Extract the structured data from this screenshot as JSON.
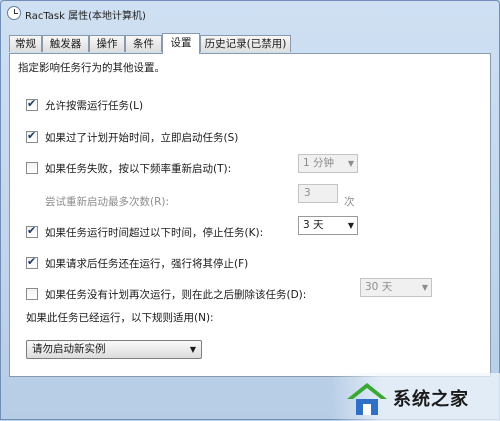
{
  "window": {
    "title": "RacTask 属性(本地计算机)"
  },
  "tabs": [
    {
      "label": "常规"
    },
    {
      "label": "触发器"
    },
    {
      "label": "操作"
    },
    {
      "label": "条件"
    },
    {
      "label": "设置"
    },
    {
      "label": "历史记录(已禁用)"
    }
  ],
  "active_tab": "设置",
  "settings": {
    "description": "指定影响任务行为的其他设置。",
    "allow_on_demand": {
      "label": "允许按需运行任务(L)",
      "checked": true
    },
    "run_after_missed": {
      "label": "如果过了计划开始时间，立即启动任务(S)",
      "checked": true
    },
    "restart_on_fail": {
      "label": "如果任务失败，按以下频率重新启动(T):",
      "checked": false,
      "interval": "1 分钟"
    },
    "restart_attempts": {
      "label": "尝试重新启动最多次数(R):",
      "value": "3",
      "unit": "次"
    },
    "stop_if_runs_longer": {
      "label": "如果任务运行时间超过以下时间，停止任务(K):",
      "checked": true,
      "duration": "3 天"
    },
    "force_stop": {
      "label": "如果请求后任务还在运行，强行将其停止(F)",
      "checked": true
    },
    "delete_if_not_scheduled": {
      "label": "如果任务没有计划再次运行，则在此之后删除该任务(D):",
      "checked": false,
      "duration": "30 天"
    },
    "rule_label": "如果此任务已经运行，以下规则适用(N):",
    "rule_value": "请勿启动新实例"
  },
  "watermark": {
    "text": "系统之家"
  },
  "colors": {
    "accent_green": "#3aa832",
    "accent_blue": "#2f6fc8",
    "checkmark": "#1f3b66"
  }
}
